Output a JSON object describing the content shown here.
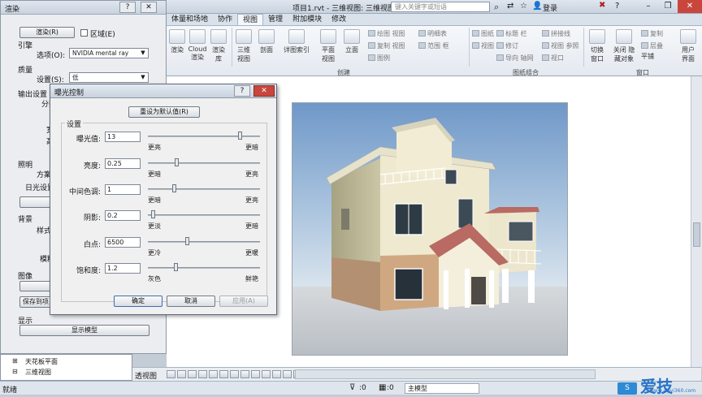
{
  "titlebar": {
    "title": "项目1.rvt - 三维视图: 三维视图 1",
    "search_placeholder": "键入关键字或短语",
    "user_label": "登录"
  },
  "menu_tabs": [
    {
      "label": "体量和场地",
      "selected": false
    },
    {
      "label": "协作",
      "selected": false
    },
    {
      "label": "视图",
      "selected": true
    },
    {
      "label": "管理",
      "selected": false
    },
    {
      "label": "附加模块",
      "selected": false
    },
    {
      "label": "修改",
      "selected": false
    }
  ],
  "ribbon": {
    "big_buttons": [
      "渲染",
      "Cloud 渲染",
      "渲染 库",
      "三维 视图",
      "剖面",
      "详图索引",
      "平面 视图",
      "立面",
      "切换 窗口",
      "关闭 隐藏对象",
      "平铺",
      "用户 界面"
    ],
    "small_col1": [
      "绘图 视图",
      "复制 视图",
      "图例"
    ],
    "small_col2": [
      "明细表",
      "范围 框"
    ],
    "small_col3": [
      "图纸",
      "视图",
      "标题 栏",
      "修订",
      "导向 轴网"
    ],
    "small_col4": [
      "拼接线",
      "视图 参照",
      "视口"
    ],
    "small_col5": [
      "复制",
      "层叠"
    ],
    "panel_create": "创建",
    "panel_sheet": "图纸组合",
    "panel_window": "窗口"
  },
  "render_panel": {
    "title": "渲染",
    "render_button": "渲染(R)",
    "region_label": "区域(E)",
    "engine_label": "引擎",
    "option_label": "选项(O):",
    "option_value": "NVIDIA mental ray",
    "quality_label": "质量",
    "setting_label": "设置(S):",
    "setting_value": "低",
    "output_label": "输出设置",
    "output_sub1": "分辨",
    "output_sub2": "宽",
    "output_sub3": "高",
    "lighting_label": "照明",
    "scheme_label": "方案",
    "sun_label": "日光设置",
    "background_label": "背景",
    "style_label": "样式",
    "blur_label": "模糊",
    "image_label": "图像",
    "save_button": "保存到项",
    "display_label": "显示",
    "show_model_button": "显示模型"
  },
  "project_browser": {
    "items": [
      "天花板平面",
      "三维视图"
    ]
  },
  "exposure_dialog": {
    "title": "曝光控制",
    "reset_button": "重设为默认值(R)",
    "group_label": "设置",
    "rows": [
      {
        "label": "曝光值:",
        "value": "13",
        "left": "更亮",
        "right": "更暗",
        "level": 0.84
      },
      {
        "label": "亮度:",
        "value": "0.25",
        "left": "更暗",
        "right": "更亮",
        "level": 0.25
      },
      {
        "label": "中间色调:",
        "value": "1",
        "left": "更暗",
        "right": "更亮",
        "level": 0.23
      },
      {
        "label": "阴影:",
        "value": "0.2",
        "left": "更淡",
        "right": "更暗",
        "level": 0.03
      },
      {
        "label": "白点:",
        "value": "6500",
        "left": "更冷",
        "right": "更暖",
        "level": 0.35
      },
      {
        "label": "饱和度:",
        "value": "1.2",
        "left": "灰色",
        "right": "鲜艳",
        "level": 0.24
      }
    ],
    "ok_button": "确定",
    "cancel_button": "取消",
    "apply_button": "应用(A)"
  },
  "view_control_bar": {
    "label": "透视图"
  },
  "status_bar": {
    "status_text": "就绪",
    "sel_count_1": ":0",
    "sel_count_2": ":0",
    "model_box": "主模型"
  },
  "watermark": {
    "text": "爱技",
    "url": "www.aijiyi360.com"
  },
  "colors": {
    "accent": "#c9463d",
    "sky": "#7fa4cf",
    "ground": "#c9cdd2",
    "wall": "#ece5cc",
    "roof": "#b86a63",
    "brick": "#c9a07a"
  }
}
